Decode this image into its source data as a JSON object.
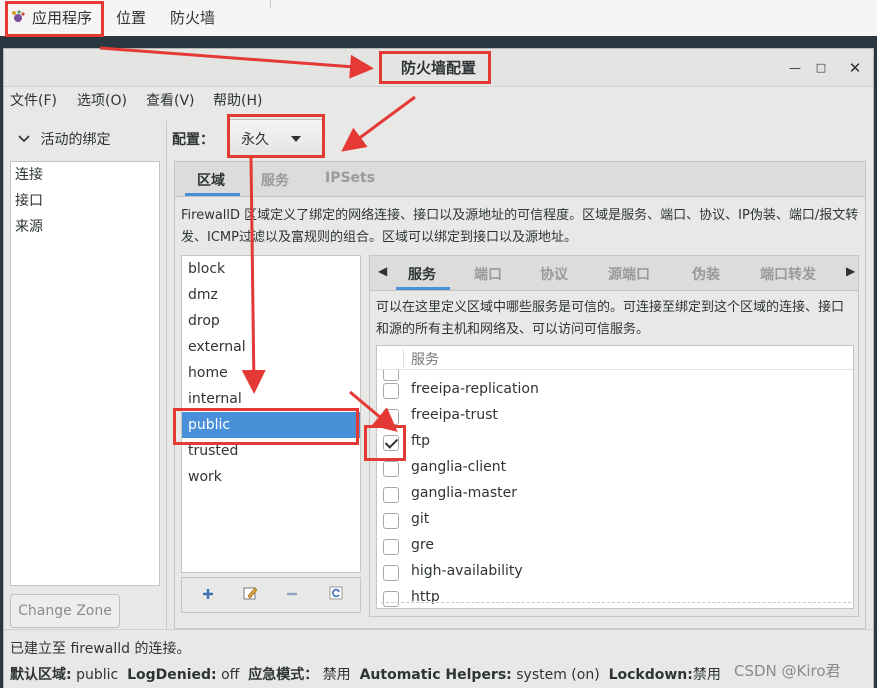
{
  "topbar": {
    "apps": "应用程序",
    "places": "位置",
    "firewall": "防火墙"
  },
  "window": {
    "title": "防火墙配置",
    "min_glyph": "—",
    "max_glyph": "□",
    "close_glyph": "✕"
  },
  "menubar": {
    "file": "文件(F)",
    "options": "选项(O)",
    "view": "查看(V)",
    "help": "帮助(H)"
  },
  "sidebar": {
    "header": "活动的绑定",
    "items": [
      "连接",
      "接口",
      "来源"
    ],
    "change_zone": "Change Zone"
  },
  "config": {
    "label": "配置：",
    "value": "永久"
  },
  "main_tabs": [
    "区域",
    "服务",
    "IPSets"
  ],
  "zone_description": "FirewallD 区域定义了绑定的网络连接、接口以及源地址的可信程度。区域是服务、端口、协议、IP伪装、端口/报文转发、ICMP过滤以及富规则的组合。区域可以绑定到接口以及源地址。",
  "zones": [
    "block",
    "dmz",
    "drop",
    "external",
    "home",
    "internal",
    "public",
    "trusted",
    "work"
  ],
  "selected_zone": "public",
  "inner_tabs": [
    "服务",
    "端口",
    "协议",
    "源端口",
    "伪装",
    "端口转发"
  ],
  "service_description": "可以在这里定义区域中哪些服务是可信的。可连接至绑定到这个区域的连接、接口和源的所有主机和网络及、可以访问可信服务。",
  "service_header": "服务",
  "services": [
    {
      "name": "freeipa-replication",
      "checked": false
    },
    {
      "name": "freeipa-trust",
      "checked": false
    },
    {
      "name": "ftp",
      "checked": true
    },
    {
      "name": "ganglia-client",
      "checked": false
    },
    {
      "name": "ganglia-master",
      "checked": false
    },
    {
      "name": "git",
      "checked": false
    },
    {
      "name": "gre",
      "checked": false
    },
    {
      "name": "high-availability",
      "checked": false
    },
    {
      "name": "http",
      "checked": false
    }
  ],
  "status": {
    "connection": "已建立至  firewalld 的连接。",
    "default_zone_label": "默认区域:",
    "default_zone": "public",
    "logdenied_label": "LogDenied:",
    "logdenied": "off",
    "panic_label": "应急模式：",
    "panic": "禁用",
    "helpers_label": "Automatic Helpers:",
    "helpers": "system (on)",
    "lockdown_label": "Lockdown:",
    "lockdown": "禁用"
  },
  "watermark": "CSDN @Kiro君",
  "colors": {
    "accent": "#4a90d9",
    "annotation": "#e53935"
  }
}
